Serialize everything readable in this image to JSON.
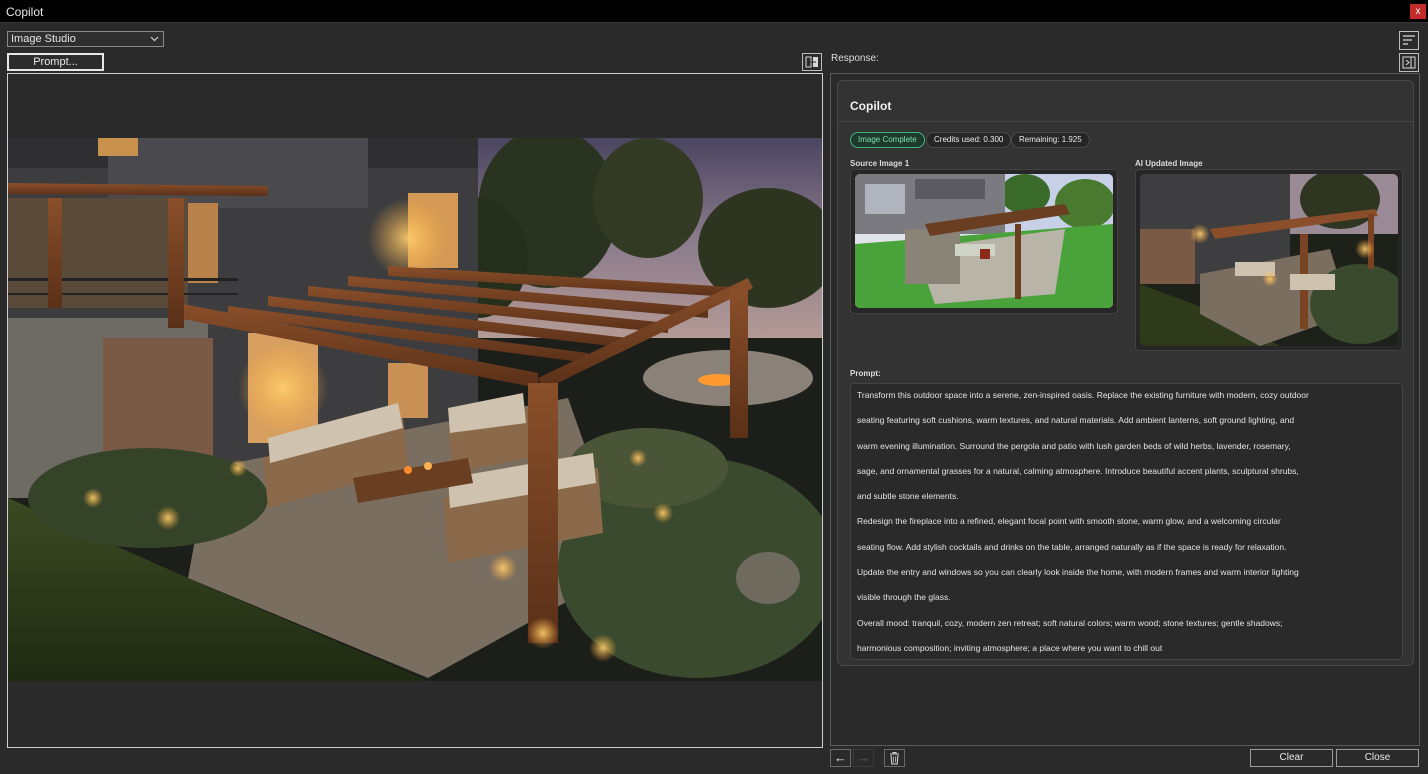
{
  "window": {
    "title": "Copilot",
    "close_glyph": "x"
  },
  "toolbar": {
    "mode_select_value": "Image Studio",
    "prompt_button_label": "Prompt..."
  },
  "response": {
    "label": "Response:",
    "card_title": "Copilot",
    "status_badge": "Image Complete",
    "credits_used": "Credits used: 0.300",
    "remaining": "Remaining: 1.925",
    "source_image_label": "Source Image 1",
    "updated_image_label": "AI Updated Image",
    "prompt_label": "Prompt:",
    "prompt_lines": [
      "Transform this outdoor space into a serene, zen-inspired oasis. Replace the existing furniture with modern, cozy outdoor",
      "seating featuring soft cushions, warm textures, and natural materials. Add ambient lanterns, soft ground lighting, and",
      "warm evening illumination. Surround the pergola and patio with lush garden beds of wild herbs, lavender, rosemary,",
      "sage, and ornamental grasses for a natural, calming atmosphere. Introduce beautiful accent plants, sculptural shrubs,",
      "and subtle stone elements.",
      "Redesign the fireplace into a refined, elegant focal point with smooth stone, warm glow, and a welcoming circular",
      "seating flow. Add stylish cocktails and drinks on the table, arranged naturally as if the space is ready for relaxation.",
      "Update the entry and windows so you can clearly look inside the home, with modern frames and warm interior lighting",
      "visible through the glass.",
      "Overall mood: tranquil, cozy, modern zen retreat; soft natural colors; warm wood; stone textures; gentle shadows;",
      "harmonious composition; inviting atmosphere; a place where you want to chill out"
    ]
  },
  "footer": {
    "back_glyph": "←",
    "forward_glyph": "→",
    "clear_label": "Clear",
    "close_label": "Close"
  },
  "icons": {
    "dropdown": "chevron-down-icon",
    "swap": "swap-panels-icon",
    "sort": "sort-lines-icon",
    "panel": "collapse-panel-icon",
    "trash": "trash-icon"
  },
  "colors": {
    "accent_green": "#3fb97a",
    "close_red": "#c42b2b",
    "background": "#2a2a2a"
  }
}
